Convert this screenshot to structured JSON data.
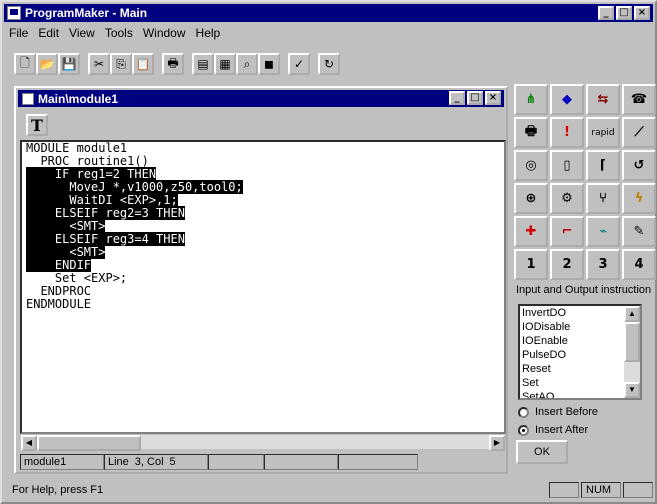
{
  "app": {
    "title": "ProgramMaker - Main"
  },
  "window_buttons": {
    "minimize": "_",
    "maximize": "□",
    "close": "×"
  },
  "menu": [
    "File",
    "Edit",
    "View",
    "Tools",
    "Window",
    "Help"
  ],
  "toolbar": [
    "new-icon",
    "open-icon",
    "save-icon",
    "cut-icon",
    "copy-icon",
    "paste-icon",
    "print-icon",
    "view-icon",
    "grid-icon",
    "find-icon",
    "cube-icon",
    "check-icon",
    "refresh-icon"
  ],
  "child": {
    "title": "Main\\module1",
    "text_tool": "T",
    "code": [
      {
        "text": "MODULE module1",
        "hl": false
      },
      {
        "text": "  PROC routine1()",
        "hl": false
      },
      {
        "text": "    IF reg1=2 THEN",
        "hl": true
      },
      {
        "text": "      MoveJ *,v1000,z50,tool0;",
        "hl": true
      },
      {
        "text": "      WaitDI <EXP>,1;",
        "hl": true
      },
      {
        "text": "    ELSEIF reg2=3 THEN",
        "hl": true
      },
      {
        "text": "      <SMT>",
        "hl": true
      },
      {
        "text": "    ELSEIF reg3=4 THEN",
        "hl": true
      },
      {
        "text": "      <SMT>",
        "hl": true
      },
      {
        "text": "    ENDIF",
        "hl": true
      },
      {
        "text": "    Set <EXP>;",
        "hl": false
      },
      {
        "text": "  ENDPROC",
        "hl": false
      },
      {
        "text": "ENDMODULE",
        "hl": false
      }
    ],
    "status": {
      "module": "module1",
      "line_label": "Line",
      "line": "3, Col",
      "col": "5"
    }
  },
  "palette": {
    "buttons": [
      "tree-icon",
      "shapes-icon",
      "arrows-icon",
      "phone-icon",
      "printer-icon",
      "exclamation-icon",
      "rapid",
      "graph-icon",
      "circle-icon",
      "phone-pad-icon",
      "bracket-icon",
      "loop-icon",
      "target-icon",
      "gear-icon",
      "split-icon",
      "lightning-icon",
      "plus-x-icon",
      "robot-icon",
      "drill-icon",
      "pencil-icon",
      "1",
      "2",
      "3",
      "4"
    ],
    "label": "Input and Output instruction",
    "list": [
      "InvertDO",
      "IODisable",
      "IOEnable",
      "PulseDO",
      "Reset",
      "Set",
      "SetAO"
    ],
    "insert_before": "Insert Before",
    "insert_after": "Insert After",
    "ok": "OK"
  },
  "statusbar": {
    "help": "For Help, press F1",
    "num": "NUM"
  }
}
